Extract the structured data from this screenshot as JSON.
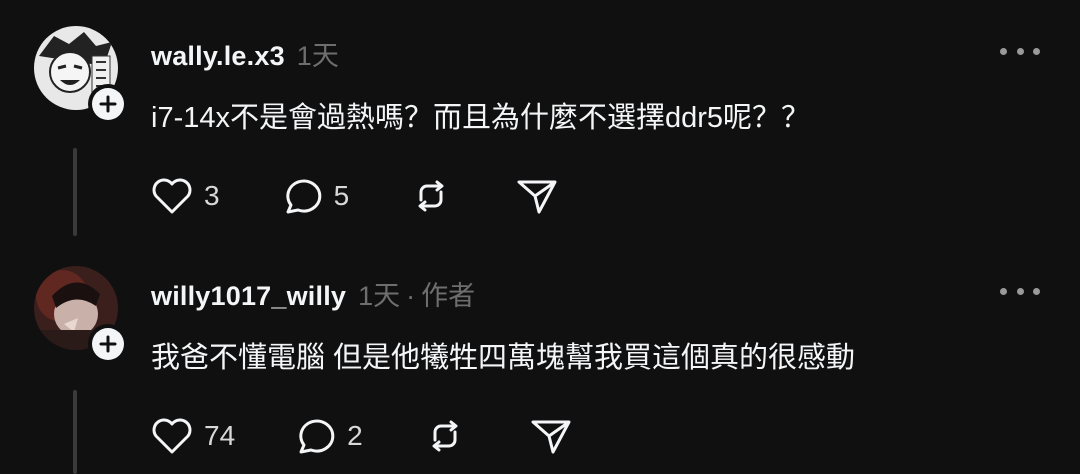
{
  "posts": [
    {
      "username": "wally.le.x3",
      "time": "1天",
      "author_tag": "",
      "text": "i7-14x不是會過熱嗎？而且為什麼不選擇ddr5呢？？",
      "likes": "3",
      "replies": "5"
    },
    {
      "username": "willy1017_willy",
      "time": "1天",
      "author_tag": "作者",
      "text": "我爸不懂電腦 但是他犧牲四萬塊幫我買這個真的很感動",
      "likes": "74",
      "replies": "2"
    }
  ],
  "icons": {
    "like": "heart-icon",
    "reply": "comment-icon",
    "repost": "repost-icon",
    "share": "send-icon",
    "more": "more-icon",
    "follow": "plus-icon"
  },
  "colors": {
    "background": "#101010",
    "primary_text": "#f3f5f7",
    "secondary_text": "#6e6e6e"
  }
}
